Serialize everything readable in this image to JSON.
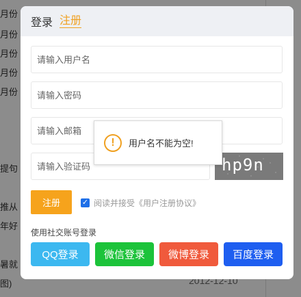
{
  "background": {
    "lines": [
      "月份",
      "月份",
      "月份",
      "月份",
      "月份",
      "提句",
      "推从",
      "年好",
      "暑就",
      "图)"
    ],
    "date": "2012-12-10"
  },
  "modal": {
    "tabs": {
      "login": "登录",
      "register": "注册"
    },
    "fields": {
      "username_placeholder": "请输入用户名",
      "password_placeholder": "请输入密码",
      "email_placeholder": "请输入邮箱",
      "captcha_placeholder": "请输入验证码"
    },
    "captcha_text": "hp9n",
    "register_button": "注册",
    "agree_text": "阅读并接受《用户注册协议》",
    "agree_checked": true,
    "social_title": "使用社交账号登录",
    "social": [
      {
        "label": "QQ登录",
        "color": "#3cb8f0"
      },
      {
        "label": "微信登录",
        "color": "#1cc33a"
      },
      {
        "label": "微博登录",
        "color": "#f05a3c"
      },
      {
        "label": "百度登录",
        "color": "#1e5ef0"
      }
    ]
  },
  "toast": {
    "icon": "warning-icon",
    "message": "用户名不能为空!"
  }
}
